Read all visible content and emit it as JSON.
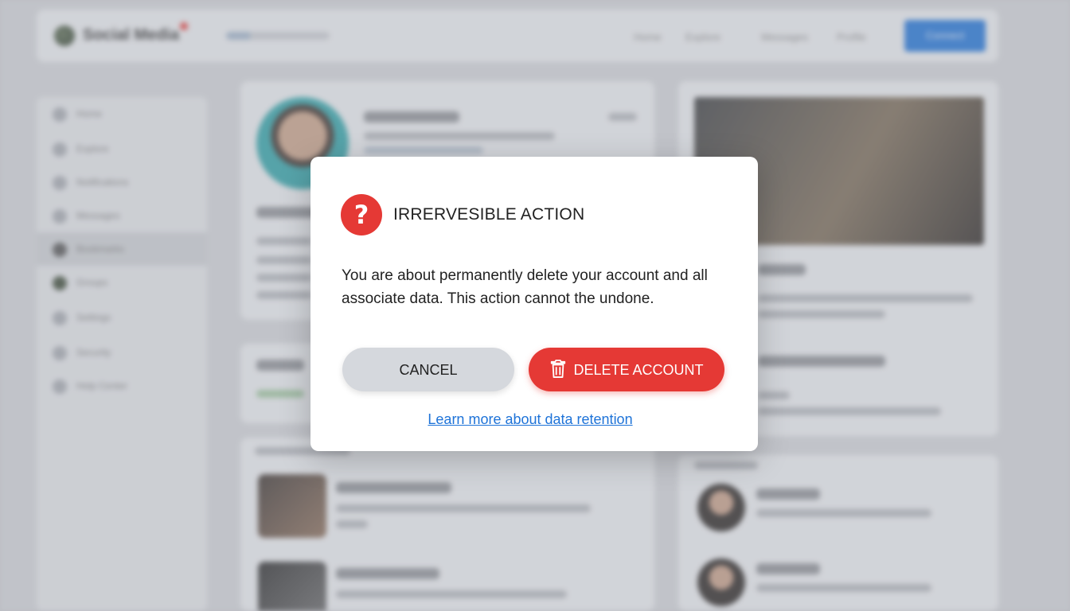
{
  "app": {
    "brand": "Social Media",
    "nav_links": [
      "Home",
      "Explore",
      "Messages",
      "Profile"
    ],
    "nav_button": "Connect"
  },
  "sidebar": {
    "items": [
      "Home",
      "Explore",
      "Notifications",
      "Messages",
      "Bookmarks",
      "Groups",
      "Settings",
      "Security",
      "Help Center"
    ]
  },
  "modal": {
    "title": "IRRERVESIBLE ACTION",
    "message": "You are about permanently delete your account and all associate data. This action cannot the undone.",
    "cancel_label": "CANCEL",
    "delete_label": "DELETE ACCOUNT",
    "link_label": "Learn more about data retention",
    "warning_icon": "question-mark-icon",
    "delete_icon": "trash-icon",
    "accent_color": "#e53935",
    "link_color": "#1e73d8"
  }
}
